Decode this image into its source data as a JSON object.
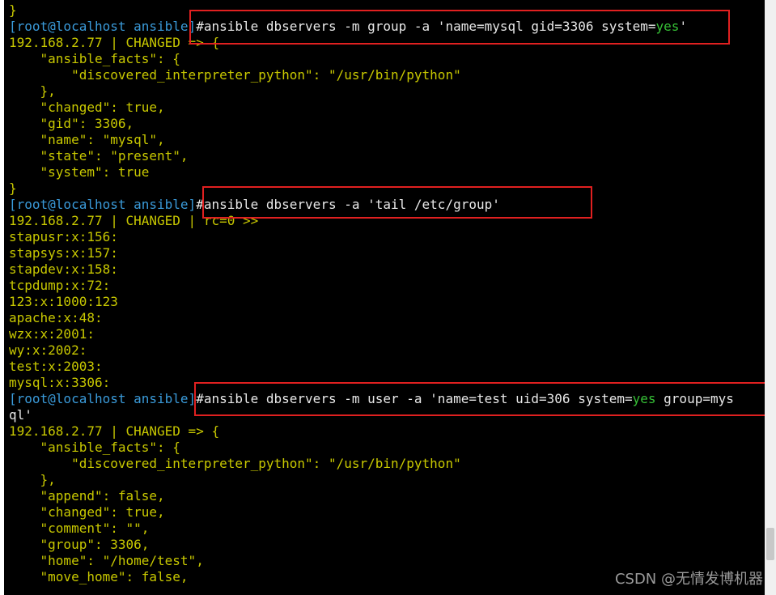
{
  "terminal": {
    "lines": [
      {
        "text": "}",
        "kind": "ok"
      },
      {
        "prompt": "[root@localhost ansible]",
        "cmd": "#ansible dbservers -m group -a 'name=mysql gid=3306 system=",
        "yes": "yes",
        "tail": "'"
      },
      {
        "text": "192.168.2.77 | CHANGED => {",
        "kind": "ok"
      },
      {
        "text": "    \"ansible_facts\": {",
        "kind": "ok"
      },
      {
        "text": "        \"discovered_interpreter_python\": \"/usr/bin/python\"",
        "kind": "ok"
      },
      {
        "text": "    },",
        "kind": "ok"
      },
      {
        "text": "    \"changed\": true,",
        "kind": "ok"
      },
      {
        "text": "    \"gid\": 3306,",
        "kind": "ok"
      },
      {
        "text": "    \"name\": \"mysql\",",
        "kind": "ok"
      },
      {
        "text": "    \"state\": \"present\",",
        "kind": "ok"
      },
      {
        "text": "    \"system\": true",
        "kind": "ok"
      },
      {
        "text": "}",
        "kind": "ok"
      },
      {
        "prompt": "[root@localhost ansible]",
        "cmd": "#ansible dbservers -a 'tail /etc/group'"
      },
      {
        "text": "192.168.2.77 | CHANGED | rc=0 >>",
        "kind": "ok"
      },
      {
        "text": "stapusr:x:156:",
        "kind": "ok"
      },
      {
        "text": "stapsys:x:157:",
        "kind": "ok"
      },
      {
        "text": "stapdev:x:158:",
        "kind": "ok"
      },
      {
        "text": "tcpdump:x:72:",
        "kind": "ok"
      },
      {
        "text": "123:x:1000:123",
        "kind": "ok"
      },
      {
        "text": "apache:x:48:",
        "kind": "ok"
      },
      {
        "text": "wzx:x:2001:",
        "kind": "ok"
      },
      {
        "text": "wy:x:2002:",
        "kind": "ok"
      },
      {
        "text": "test:x:2003:",
        "kind": "ok"
      },
      {
        "text": "mysql:x:3306:",
        "kind": "ok"
      },
      {
        "prompt": "[root@localhost ansible]",
        "cmd": "#ansible dbservers -m user -a 'name=test uid=306 system=",
        "yes": "yes",
        "tail": " group=mys"
      },
      {
        "text": "ql'",
        "kind": "cmd"
      },
      {
        "text": "192.168.2.77 | CHANGED => {",
        "kind": "ok"
      },
      {
        "text": "    \"ansible_facts\": {",
        "kind": "ok"
      },
      {
        "text": "        \"discovered_interpreter_python\": \"/usr/bin/python\"",
        "kind": "ok"
      },
      {
        "text": "    },",
        "kind": "ok"
      },
      {
        "text": "    \"append\": false,",
        "kind": "ok"
      },
      {
        "text": "    \"changed\": true,",
        "kind": "ok"
      },
      {
        "text": "    \"comment\": \"\",",
        "kind": "ok"
      },
      {
        "text": "    \"group\": 3306,",
        "kind": "ok"
      },
      {
        "text": "    \"home\": \"/home/test\",",
        "kind": "ok"
      },
      {
        "text": "    \"move_home\": false,",
        "kind": "ok"
      }
    ]
  },
  "watermark": "CSDN @无情发博机器",
  "colors": {
    "background": "#000000",
    "prompt": "#3a9ad9",
    "command": "#e8e8e8",
    "output": "#c8c800",
    "yes": "#36c036",
    "highlight_box": "#e02020"
  }
}
